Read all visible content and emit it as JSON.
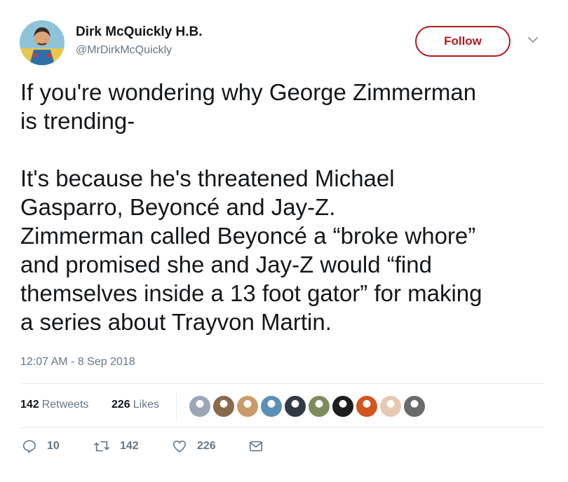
{
  "user": {
    "display_name": "Dirk McQuickly H.B.",
    "handle": "@MrDirkMcQuickly"
  },
  "header": {
    "follow_label": "Follow",
    "menu_icon": "chevron-down-icon"
  },
  "tweet": {
    "text": "If you're wondering why George Zimmerman\nis trending-\n\nIt's because he's threatened Michael\nGasparro, Beyoncé and Jay-Z.\nZimmerman called Beyoncé a “broke whore”\nand promised she and Jay-Z would “find\nthemselves inside a 13 foot gator” for making\na series about Trayvon Martin.",
    "timestamp": "12:07 AM - 8 Sep 2018"
  },
  "stats": {
    "retweets_count": "142",
    "retweets_label": "Retweets",
    "likes_count": "226",
    "likes_label": "Likes"
  },
  "actions": {
    "reply_count": "10",
    "retweet_count": "142",
    "like_count": "226",
    "reply_icon": "reply-icon",
    "retweet_icon": "retweet-icon",
    "like_icon": "heart-icon",
    "dm_icon": "envelope-icon"
  },
  "liker_colors": [
    "#9aa7b8",
    "#8a6a4c",
    "#c99b6a",
    "#5b8fb3",
    "#2f3a44",
    "#7d8c5a",
    "#1d1d1d",
    "#d4541f",
    "#e6c9b3",
    "#6a6a6a"
  ],
  "colors": {
    "follow_accent": "#b1191f",
    "secondary_text": "#657786",
    "primary_text": "#14171a",
    "divider": "#e6ecf0"
  }
}
